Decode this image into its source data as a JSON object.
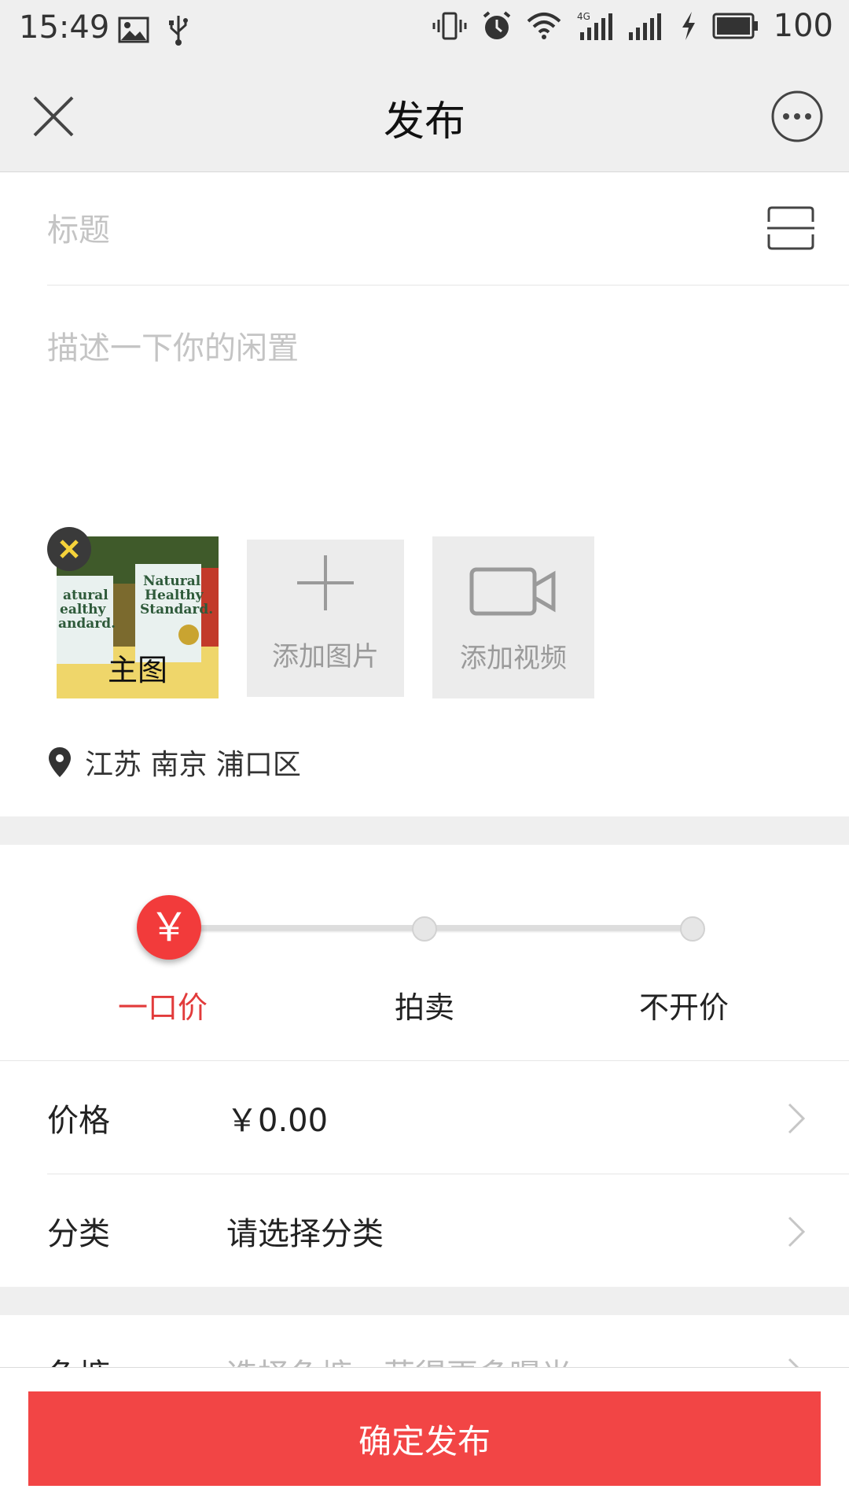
{
  "status_bar": {
    "time": "15:49",
    "battery": "100",
    "network": "4G"
  },
  "header": {
    "title": "发布"
  },
  "form": {
    "title_placeholder": "标题",
    "description_placeholder": "描述一下你的闲置"
  },
  "media": {
    "main_photo_label": "主图",
    "add_image_label": "添加图片",
    "add_video_label": "添加视频"
  },
  "location": {
    "text": "江苏 南京 浦口区"
  },
  "price_mode": {
    "options": [
      "一口价",
      "拍卖",
      "不开价"
    ],
    "selected": "一口价",
    "selected_icon": "￥"
  },
  "fields": {
    "price_label": "价格",
    "price_value": "￥0.00",
    "category_label": "分类",
    "category_value": "请选择分类",
    "partial_label": "鱼塘",
    "partial_value": "选择鱼塘，获得更多曝光"
  },
  "submit": {
    "label": "确定发布"
  },
  "colors": {
    "accent": "#f24545",
    "background_band": "#efefef",
    "placeholder": "#c4c4c4"
  }
}
